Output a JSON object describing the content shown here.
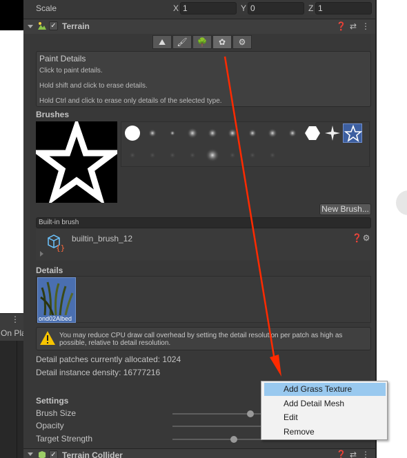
{
  "left_panel": {
    "truncated_label": "On Pla",
    "menu_icon": "vertical-dots-icon"
  },
  "transform": {
    "scale_label": "Scale",
    "x_label": "X",
    "x_value": "1",
    "y_label": "Y",
    "y_value": "0",
    "z_label": "Z",
    "z_value": "1"
  },
  "terrain": {
    "title": "Terrain",
    "enabled": true,
    "tools": [
      {
        "name": "raise-lower-terrain-icon",
        "glyph": "⛰"
      },
      {
        "name": "paint-brush-icon",
        "glyph": "🖌"
      },
      {
        "name": "paint-trees-icon",
        "glyph": "🌳"
      },
      {
        "name": "paint-details-icon",
        "glyph": "✿"
      },
      {
        "name": "terrain-settings-icon",
        "glyph": "⚙"
      }
    ],
    "active_tool_index": 3,
    "help": {
      "title": "Paint Details",
      "line1": "Click to paint details.",
      "line2": "Hold shift and click to erase details.",
      "line3": "Hold Ctrl and click to erase only details of the selected type."
    },
    "brushes_label": "Brushes",
    "new_brush_button": "New Brush...",
    "brush_name_field": "Built-in brush",
    "brush_asset_name": "builtin_brush_12",
    "details_label": "Details",
    "detail_item_label": "ond02Albed",
    "warning_text": "You may reduce CPU draw call overhead by setting the detail resolution per patch as high as possible, relative to detail resolution.",
    "patches_text": "Detail patches currently allocated: 1024",
    "density_text": "Detail instance density: 16777216",
    "settings_label": "Settings",
    "settings": [
      {
        "label": "Brush Size",
        "fraction": 0.45
      },
      {
        "label": "Opacity",
        "fraction": 0.0
      },
      {
        "label": "Target Strength",
        "fraction": 0.35
      }
    ]
  },
  "terrain_collider": {
    "title": "Terrain Collider",
    "enabled": true
  },
  "context_menu": {
    "items": [
      {
        "label": "Add Grass Texture",
        "highlighted": true
      },
      {
        "label": "Add Detail Mesh",
        "highlighted": false
      },
      {
        "label": "Edit",
        "highlighted": false
      },
      {
        "label": "Remove",
        "highlighted": false
      }
    ]
  },
  "colors": {
    "annotation_arrow": "#ff2a00",
    "menu_highlight": "#99c9ef",
    "selected_brush": "#3d5fa0"
  }
}
